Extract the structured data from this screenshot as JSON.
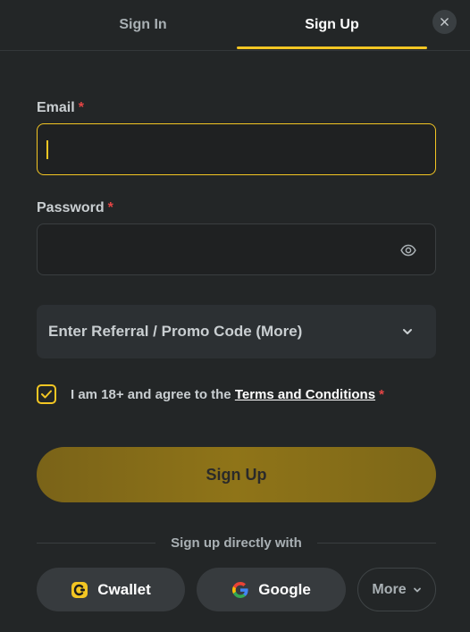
{
  "tabs": {
    "signin_label": "Sign In",
    "signup_label": "Sign Up",
    "active": "Sign Up"
  },
  "close_icon": "close-icon",
  "email": {
    "label": "Email",
    "required_mark": "*",
    "value": "",
    "placeholder": ""
  },
  "password": {
    "label": "Password",
    "required_mark": "*",
    "value": "",
    "placeholder": "",
    "toggle_icon": "eye-icon"
  },
  "promo": {
    "label": "Enter Referral / Promo Code (More)",
    "icon": "chevron-down-icon"
  },
  "agreement": {
    "checked": true,
    "prefix": "I am 18+ and agree to the ",
    "link_text": "Terms and Conditions",
    "required_mark": "*"
  },
  "signup_button": {
    "label": "Sign Up"
  },
  "social": {
    "divider_text": "Sign up directly with",
    "cwallet_label": "Cwallet",
    "google_label": "Google",
    "more_label": "More"
  },
  "colors": {
    "accent": "#f3c623",
    "background": "#232627",
    "required": "#e54545"
  }
}
